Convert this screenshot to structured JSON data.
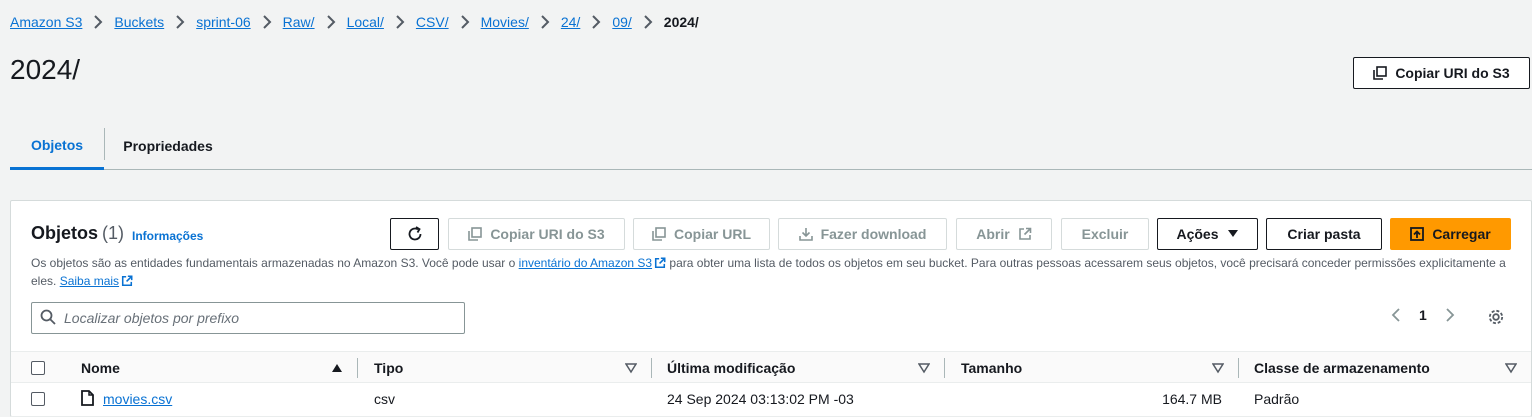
{
  "breadcrumb": {
    "items": [
      "Amazon S3",
      "Buckets",
      "sprint-06",
      "Raw/",
      "Local/",
      "CSV/",
      "Movies/",
      "24/",
      "09/"
    ],
    "current": "2024/"
  },
  "page": {
    "title": "2024/"
  },
  "header_actions": {
    "copy_uri": "Copiar URI do S3"
  },
  "tabs": [
    {
      "label": "Objetos",
      "active": true
    },
    {
      "label": "Propriedades",
      "active": false
    }
  ],
  "objects_panel": {
    "title": "Objetos",
    "count": "(1)",
    "info_link": "Informações",
    "toolbar": {
      "copy_uri": "Copiar URI do S3",
      "copy_url": "Copiar URL",
      "download": "Fazer download",
      "open": "Abrir",
      "delete": "Excluir",
      "actions": "Ações",
      "create_folder": "Criar pasta",
      "upload": "Carregar"
    },
    "description": {
      "part1": "Os objetos são as entidades fundamentais armazenadas no Amazon S3. Você pode usar o ",
      "link1": "inventário do Amazon S3",
      "part2": " para obter uma lista de todos os objetos em seu bucket. Para outras pessoas acessarem seus objetos, você precisará conceder permissões explicitamente a eles. ",
      "link2": "Saiba mais"
    },
    "search": {
      "placeholder": "Localizar objetos por prefixo"
    },
    "pagination": {
      "page": "1"
    },
    "table": {
      "columns": [
        "Nome",
        "Tipo",
        "Última modificação",
        "Tamanho",
        "Classe de armazenamento"
      ],
      "rows": [
        {
          "name": "movies.csv",
          "type": "csv",
          "modified": "24 Sep 2024 03:13:02 PM -03",
          "size": "164.7 MB",
          "storage_class": "Padrão"
        }
      ]
    }
  },
  "colors": {
    "link": "#0972d3",
    "primary_button": "#ff9900",
    "background": "#f2f3f3"
  },
  "icons": [
    "chevron-right-icon",
    "copy-icon",
    "refresh-icon",
    "download-icon",
    "external-link-icon",
    "caret-down-icon",
    "upload-icon",
    "search-icon",
    "chevron-left-icon",
    "gear-icon",
    "sort-up-icon",
    "sort-down-icon",
    "file-icon"
  ]
}
